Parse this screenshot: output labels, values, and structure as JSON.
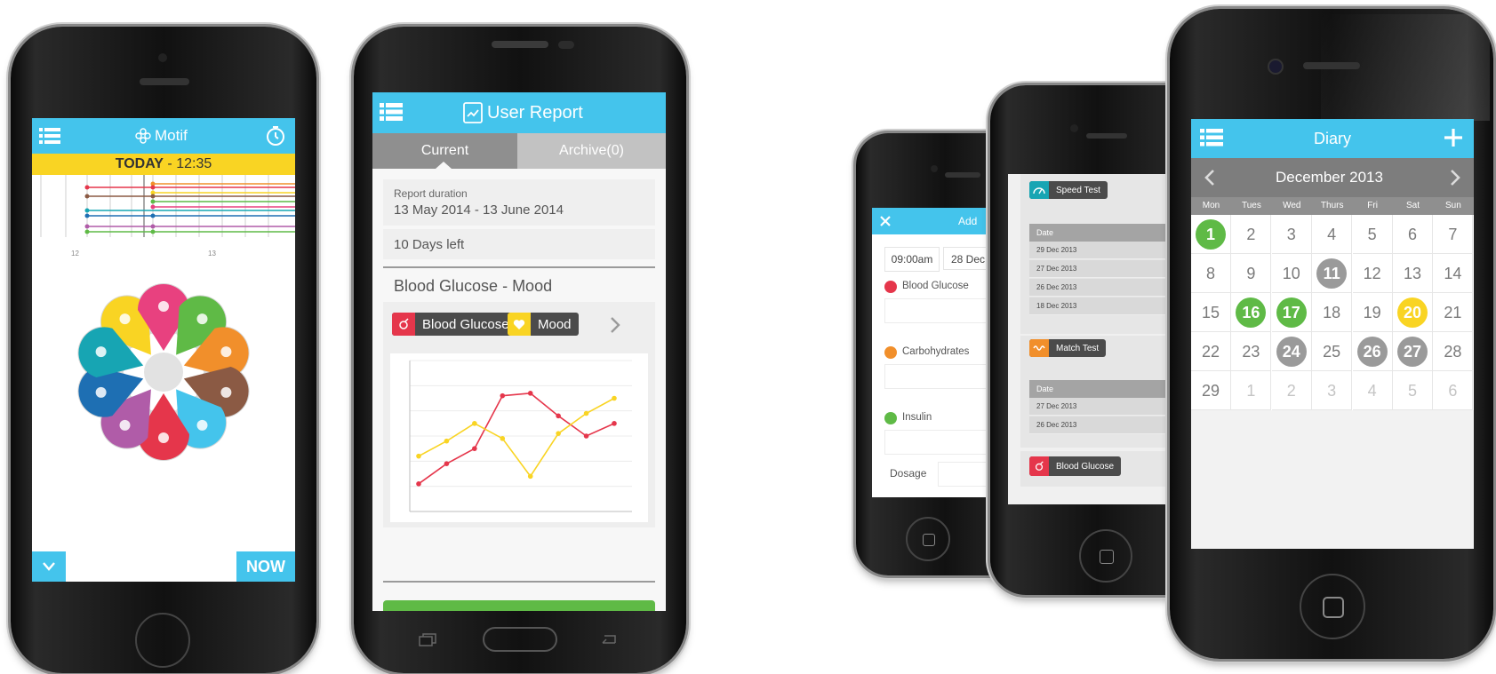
{
  "colors": {
    "blue": "#44c4ec",
    "green": "#5fba46",
    "grey": "#9a9a9a",
    "yellow": "#f9d423",
    "red": "#e5364b",
    "orange": "#f18f2b",
    "teal": "#17a5b3"
  },
  "phone1": {
    "title": "Motif",
    "today_label": "TODAY",
    "time": " - 12:35",
    "tick_left": "12",
    "tick_right": "13",
    "now_button": "NOW",
    "petals": [
      "heart-icon",
      "lightning-icon",
      "hand-icon",
      "exercise-icon",
      "move-icon",
      "pulse-icon",
      "on-off-icon",
      "runner-icon",
      "moon-stars-icon",
      "water-drop-icon"
    ]
  },
  "phone2": {
    "title": "User Report",
    "tab_current": "Current",
    "tab_archive": "Archive(0)",
    "duration_label": "Report duration",
    "duration_value": "13 May 2014 - 13 June 2014",
    "days_left": "10 Days left",
    "section_title": "Blood Glucose - Mood",
    "tag_glucose": "Blood Glucose",
    "tag_mood": "Mood"
  },
  "chart_data": {
    "type": "line",
    "x": [
      1,
      2,
      3,
      4,
      5,
      6,
      7,
      8
    ],
    "series": [
      {
        "color": "#e5364b",
        "values": [
          1.1,
          1.9,
          2.5,
          4.6,
          4.7,
          3.8,
          3.0,
          3.5
        ]
      },
      {
        "color": "#f9d423",
        "values": [
          2.2,
          2.8,
          3.5,
          2.9,
          1.4,
          3.1,
          3.9,
          4.5
        ]
      }
    ],
    "ylim": [
      0,
      6
    ],
    "grid": true
  },
  "phone3": {
    "header": "Add",
    "time": "09:00am",
    "date": "28 Dec",
    "field1": "Blood Glucose",
    "field2": "Carbohydrates",
    "field3": "Insulin",
    "dosage_label": "Dosage"
  },
  "phone4": {
    "tag_speed": "Speed Test",
    "date_header": "Date",
    "speed_dates": [
      "29 Dec 2013",
      "27 Dec 2013",
      "26 Dec 2013",
      "18 Dec 2013"
    ],
    "tag_match": "Match Test",
    "match_dates": [
      "27 Dec 2013",
      "26 Dec 2013"
    ],
    "tag_glucose": "Blood Glucose"
  },
  "phone5": {
    "title": "Diary",
    "month": "December 2013",
    "weekdays": [
      "Mon",
      "Tues",
      "Wed",
      "Thurs",
      "Fri",
      "Sat",
      "Sun"
    ],
    "weeks": [
      [
        "1",
        "2",
        "3",
        "4",
        "5",
        "6",
        "7"
      ],
      [
        "8",
        "9",
        "10",
        "11",
        "12",
        "13",
        "14"
      ],
      [
        "15",
        "16",
        "17",
        "18",
        "19",
        "20",
        "21"
      ],
      [
        "22",
        "23",
        "24",
        "25",
        "26",
        "27",
        "28"
      ],
      [
        "29",
        "1",
        "2",
        "3",
        "4",
        "5",
        "6"
      ]
    ]
  }
}
